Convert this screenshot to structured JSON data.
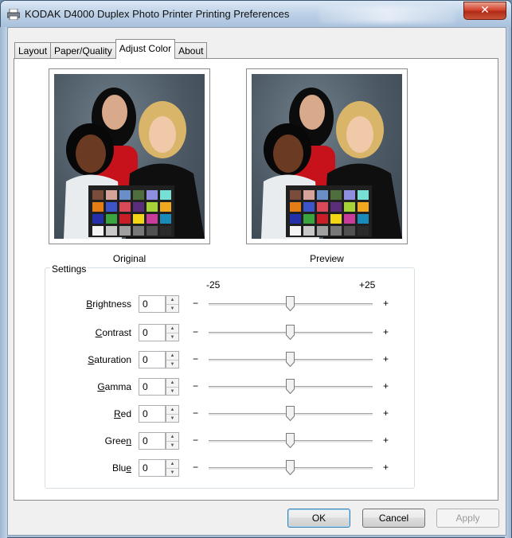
{
  "window": {
    "title": "KODAK D4000 Duplex Photo Printer Printing Preferences",
    "close_label": "✕"
  },
  "tabs": [
    {
      "label": "Layout",
      "active": false
    },
    {
      "label": "Paper/Quality",
      "active": false
    },
    {
      "label": "Adjust Color",
      "active": true
    },
    {
      "label": "About",
      "active": false
    }
  ],
  "images": {
    "original_caption": "Original",
    "preview_caption": "Preview"
  },
  "settings": {
    "legend": "Settings",
    "scale_min": "-25",
    "scale_max": "+25",
    "minus_glyph": "−",
    "plus_glyph": "+",
    "rows": [
      {
        "pre": "",
        "ul": "B",
        "post": "rightness",
        "value": "0"
      },
      {
        "pre": "",
        "ul": "C",
        "post": "ontrast",
        "value": "0"
      },
      {
        "pre": "",
        "ul": "S",
        "post": "aturation",
        "value": "0"
      },
      {
        "pre": "",
        "ul": "G",
        "post": "amma",
        "value": "0"
      },
      {
        "pre": "",
        "ul": "R",
        "post": "ed",
        "value": "0"
      },
      {
        "pre": "Gree",
        "ul": "n",
        "post": "",
        "value": "0"
      },
      {
        "pre": "Blu",
        "ul": "e",
        "post": "",
        "value": "0"
      }
    ]
  },
  "buttons": {
    "ok": "OK",
    "cancel": "Cancel",
    "apply": "Apply"
  },
  "colors": {
    "title_bar": "#bcd0e6",
    "close_button": "#d3462f",
    "default_button_border": "#3c7fb1"
  }
}
